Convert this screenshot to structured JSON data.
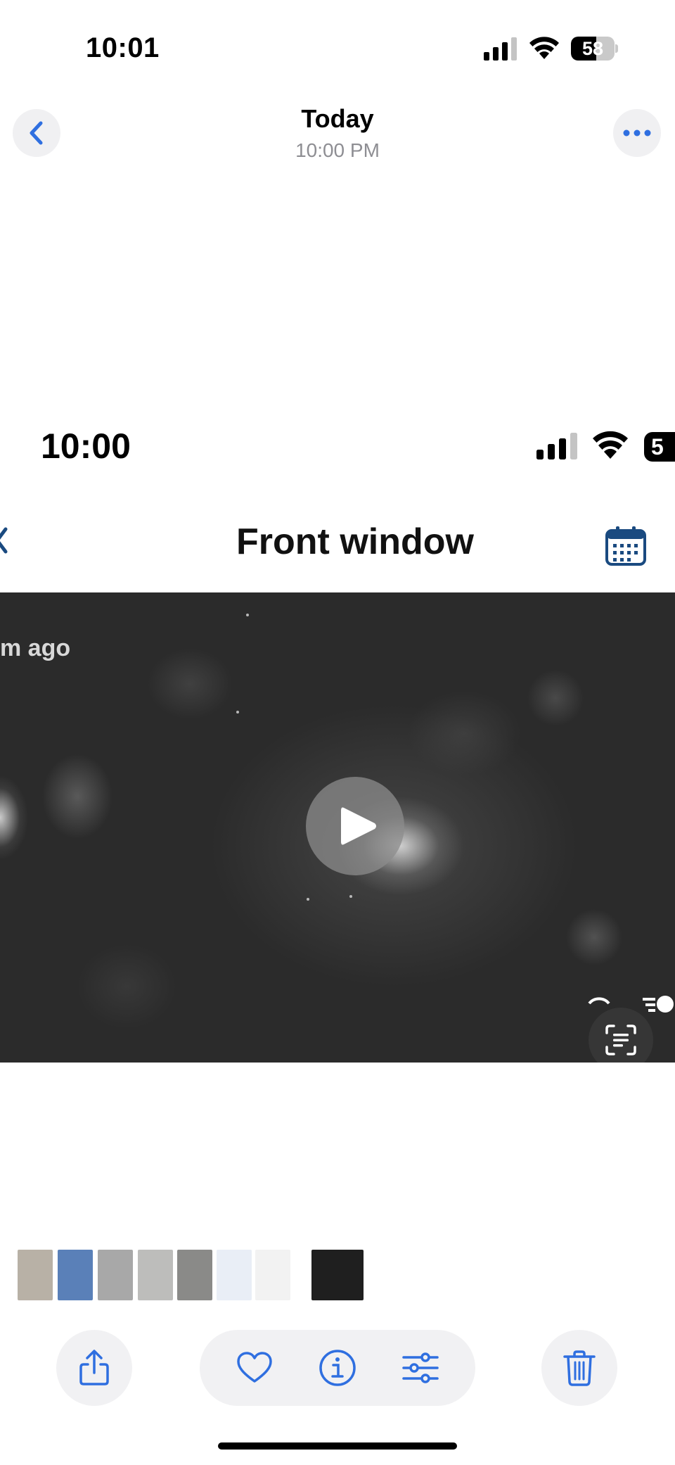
{
  "status_bar": {
    "time": "10:01",
    "battery_percent": 58,
    "battery_label": "58"
  },
  "nav": {
    "title": "Today",
    "subtitle": "10:00 PM",
    "back_icon": "chevron-left-icon",
    "more_icon": "ellipsis-icon",
    "accent_color": "#2f6fe0"
  },
  "photo": {
    "status_bar": {
      "time": "10:00",
      "battery_label": "5"
    },
    "title": "Front window",
    "calendar_icon": "calendar-icon",
    "video": {
      "timestamp_label": "m ago",
      "play_icon": "play-icon",
      "live_text_icon": "live-text-icon"
    }
  },
  "thumbnails": [
    {
      "name": "thumb-1",
      "color": "#b8b1a6"
    },
    {
      "name": "thumb-2",
      "color": "#5a80b8"
    },
    {
      "name": "thumb-3",
      "color": "#a8a8a8"
    },
    {
      "name": "thumb-4",
      "color": "#bdbdbb"
    },
    {
      "name": "thumb-5",
      "color": "#8a8a88"
    },
    {
      "name": "thumb-6",
      "color": "#e9eef6"
    },
    {
      "name": "thumb-7",
      "color": "#f2f2f2"
    },
    {
      "name": "thumb-8-current",
      "color": "#1f1f1f"
    }
  ],
  "toolbar": {
    "share_icon": "share-icon",
    "favorite_icon": "heart-icon",
    "info_icon": "info-icon",
    "adjust_icon": "adjust-sliders-icon",
    "delete_icon": "trash-icon"
  }
}
